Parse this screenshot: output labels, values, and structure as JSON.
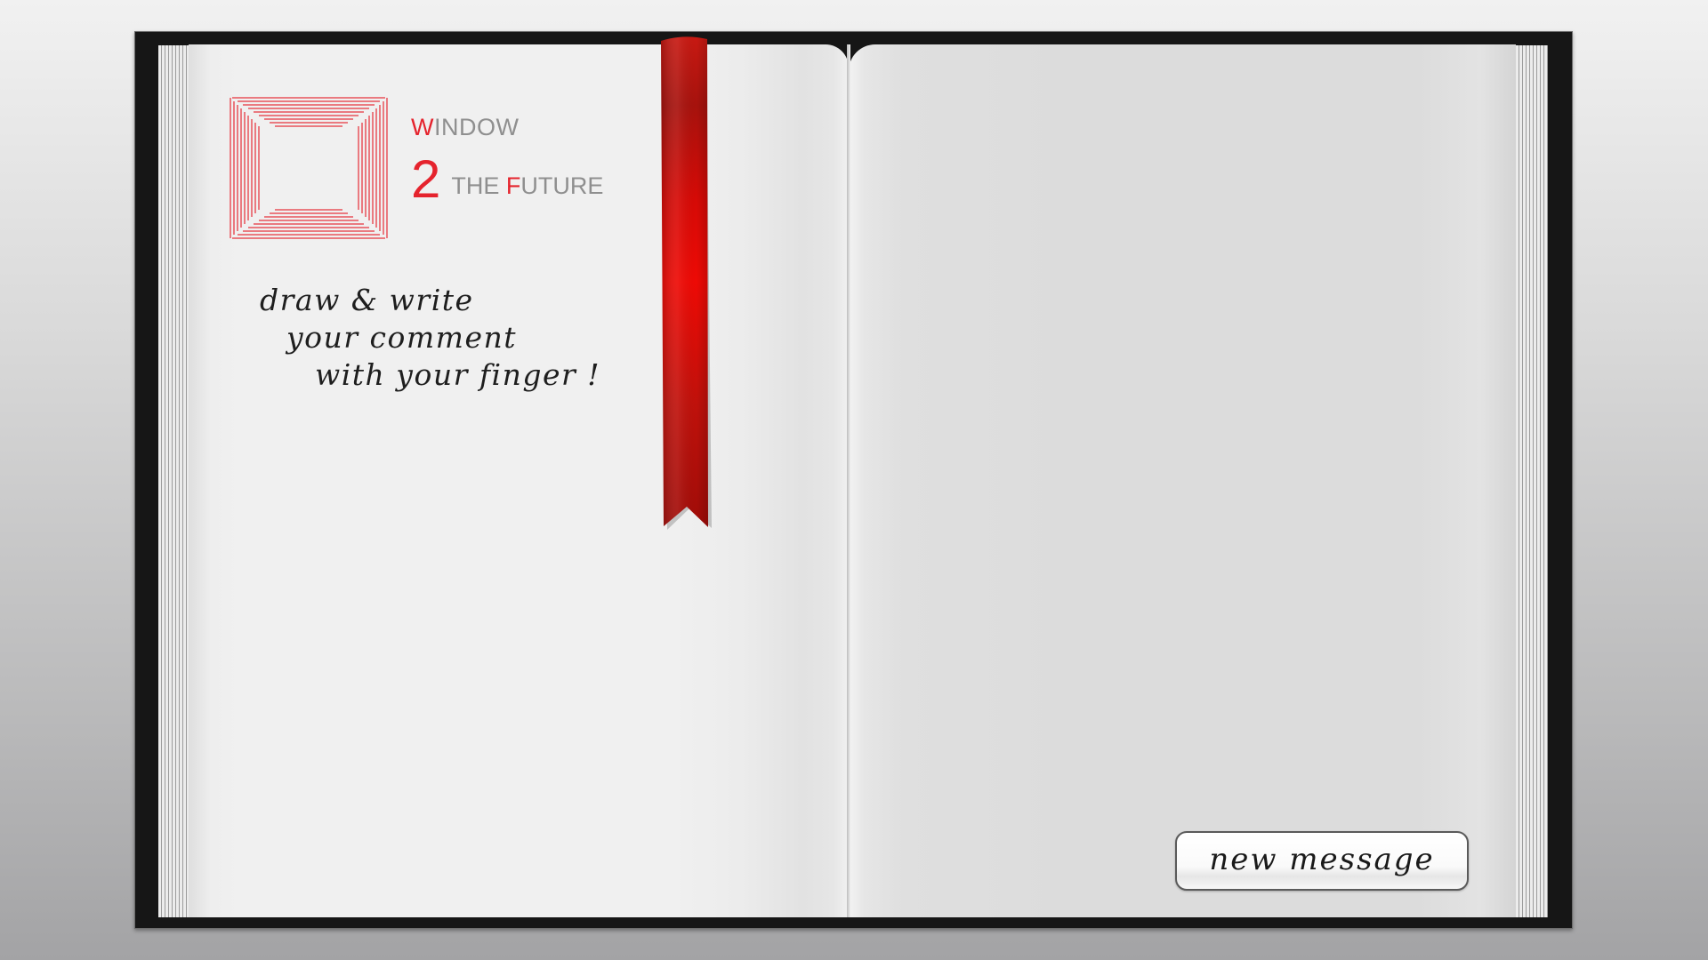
{
  "logo": {
    "line1_first": "W",
    "line1_rest": "INDOW",
    "number": "2",
    "line2_the": "THE ",
    "line2_first": "F",
    "line2_rest": "UTURE"
  },
  "instructions": {
    "line1": "draw & write",
    "line2": "your comment",
    "line3": "with your finger !"
  },
  "new_message_button": {
    "label": "new message"
  },
  "colors": {
    "accent": "#e5232d",
    "ribbon": "#d40c0c",
    "cover": "#161616"
  }
}
